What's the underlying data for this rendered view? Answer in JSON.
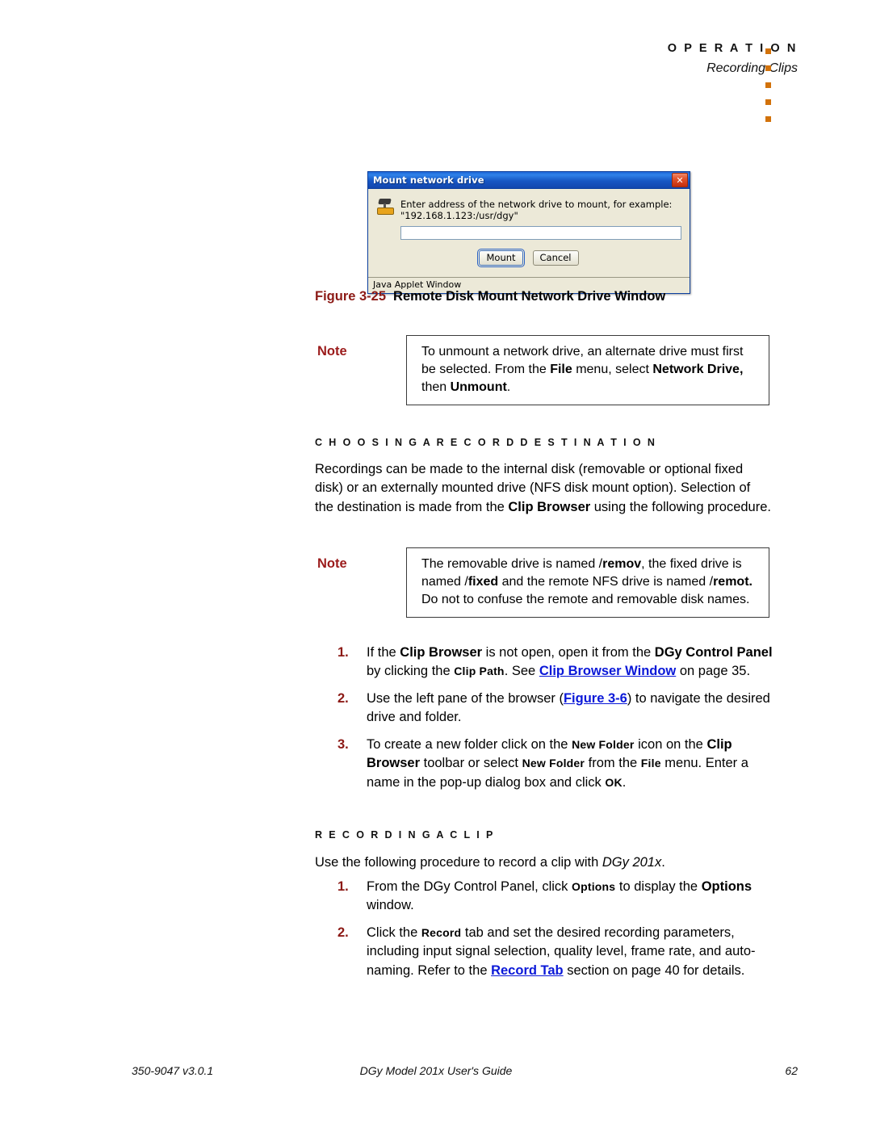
{
  "header": {
    "section": "O P E R A T I O N",
    "subsection": "Recording Clips",
    "dot_color": "#d2720a",
    "dot_count": 5
  },
  "figure_dialog": {
    "title": "Mount network drive",
    "close_icon": "close-icon",
    "drive_icon": "network-drive-icon",
    "prompt": "Enter address of the network drive to mount, for example:  \"192.168.1.123:/usr/dgy\"",
    "input_value": "",
    "buttons": {
      "primary": "Mount",
      "secondary": "Cancel"
    },
    "statusbar": "Java Applet Window"
  },
  "figure_caption": {
    "number": "Figure 3-25",
    "title": "Remote Disk Mount Network Drive Window",
    "number_color": "#8c1a16"
  },
  "note_1": {
    "label": "Note",
    "runs": [
      {
        "t": "To unmount a network drive, an alternate drive must first be selected. From the ",
        "s": "n"
      },
      {
        "t": "File",
        "s": "b"
      },
      {
        "t": " menu, select ",
        "s": "n"
      },
      {
        "t": "Network Drive,",
        "s": "b"
      },
      {
        "t": " then ",
        "s": "n"
      },
      {
        "t": "Unmount",
        "s": "b"
      },
      {
        "t": ".",
        "s": "n"
      }
    ]
  },
  "section_choosing": {
    "heading": "C H O O S I N G   A   R E C O R D   D E S T I N A T I O N",
    "paragraph_runs": [
      {
        "t": "Recordings can be made to the internal disk (removable or optional fixed disk) or an externally mounted drive (NFS disk mount option). Selection of the destination is made from the ",
        "s": "n"
      },
      {
        "t": "Clip Browser",
        "s": "b"
      },
      {
        "t": " using the following procedure.",
        "s": "n"
      }
    ]
  },
  "note_2": {
    "label": "Note",
    "runs": [
      {
        "t": "The removable drive is named /",
        "s": "n"
      },
      {
        "t": "remov",
        "s": "b"
      },
      {
        "t": ", the fixed drive is named /",
        "s": "n"
      },
      {
        "t": "fixed",
        "s": "b"
      },
      {
        "t": " and the remote NFS drive is named /",
        "s": "n"
      },
      {
        "t": "remot.",
        "s": "b"
      },
      {
        "t": " Do not to confuse the remote and removable disk names.",
        "s": "n"
      }
    ]
  },
  "list_choosing": [
    {
      "num": "1.",
      "runs": [
        {
          "t": "If the ",
          "s": "n"
        },
        {
          "t": "Clip Browser",
          "s": "b"
        },
        {
          "t": " is not open, open it from the ",
          "s": "n"
        },
        {
          "t": "DGy Control Panel",
          "s": "b"
        },
        {
          "t": " by clicking the ",
          "s": "n"
        },
        {
          "t": "Clip Path",
          "s": "sb"
        },
        {
          "t": ". See ",
          "s": "n"
        },
        {
          "t": "Clip Browser Window",
          "s": "x"
        },
        {
          "t": " on page 35.",
          "s": "n"
        }
      ]
    },
    {
      "num": "2.",
      "runs": [
        {
          "t": "Use the left pane of the browser (",
          "s": "n"
        },
        {
          "t": "Figure 3-6",
          "s": "x"
        },
        {
          "t": ") to navigate the desired drive and folder.",
          "s": "n"
        }
      ]
    },
    {
      "num": "3.",
      "runs": [
        {
          "t": "To create a new folder click on the ",
          "s": "n"
        },
        {
          "t": "New Folder",
          "s": "sb"
        },
        {
          "t": " icon on the ",
          "s": "n"
        },
        {
          "t": "Clip Browser",
          "s": "b"
        },
        {
          "t": " toolbar or select ",
          "s": "n"
        },
        {
          "t": "New Folder",
          "s": "sb"
        },
        {
          "t": " from the ",
          "s": "n"
        },
        {
          "t": "File",
          "s": "sb"
        },
        {
          "t": " menu. Enter a name in the pop-up dialog box and click ",
          "s": "n"
        },
        {
          "t": "OK",
          "s": "sb"
        },
        {
          "t": ".",
          "s": "n"
        }
      ]
    }
  ],
  "section_recording": {
    "heading": "R E C O R D I N G   A   C L I P",
    "paragraph_runs": [
      {
        "t": "Use the following procedure to record a clip with ",
        "s": "n"
      },
      {
        "t": "DGy 201x",
        "s": "i"
      },
      {
        "t": ".",
        "s": "n"
      }
    ]
  },
  "list_recording": [
    {
      "num": "1.",
      "runs": [
        {
          "t": "From the DGy Control Panel, click ",
          "s": "n"
        },
        {
          "t": "Options",
          "s": "sb"
        },
        {
          "t": " to display the ",
          "s": "n"
        },
        {
          "t": "Options",
          "s": "b"
        },
        {
          "t": " window.",
          "s": "n"
        }
      ]
    },
    {
      "num": "2.",
      "runs": [
        {
          "t": "Click the ",
          "s": "n"
        },
        {
          "t": "Record",
          "s": "sb"
        },
        {
          "t": " tab and set the desired recording parameters, including input signal selection, quality level, frame rate, and auto-naming. Refer to the ",
          "s": "n"
        },
        {
          "t": "Record Tab",
          "s": "x"
        },
        {
          "t": " section on page 40 for details.",
          "s": "n"
        }
      ]
    }
  ],
  "footer": {
    "left": "350-9047 v3.0.1",
    "center": "DGy Model 201x User's Guide",
    "right": "62"
  }
}
